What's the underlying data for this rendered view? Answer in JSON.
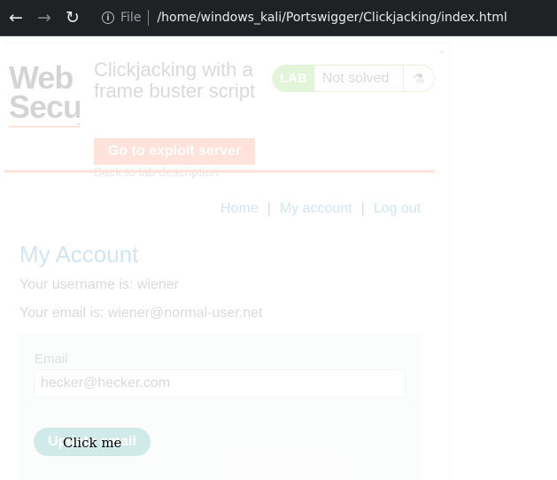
{
  "browser": {
    "file_label": "File",
    "url": "/home/windows_kali/Portswigger/Clickjacking/index.html"
  },
  "site": {
    "logo_text": "Web Security Academy",
    "lab_title": "Clickjacking with a frame buster script",
    "exploit_button": "Go to exploit server",
    "back_link": "Back to lab description",
    "lab_badge": {
      "tag": "LAB",
      "status": "Not solved"
    },
    "nav": {
      "home": "Home",
      "my_account": "My account",
      "logout": "Log out",
      "separator": "|"
    },
    "heading": "My Account",
    "username_line": "Your username is: wiener",
    "email_line": "Your email is: wiener@normal-user.net",
    "form": {
      "email_label": "Email",
      "email_value": "hecker@hecker.com",
      "submit_label": "Update email"
    }
  },
  "decoy": {
    "label": "Click me"
  },
  "colors": {
    "brand_orange": "#ff6633",
    "lab_green": "#66cc33",
    "link_blue": "#0071bc",
    "button_teal": "#008b8b",
    "chrome_bg": "#202124"
  },
  "icons": [
    "back-arrow-icon",
    "forward-arrow-icon",
    "reload-icon",
    "info-icon",
    "flask-icon"
  ]
}
